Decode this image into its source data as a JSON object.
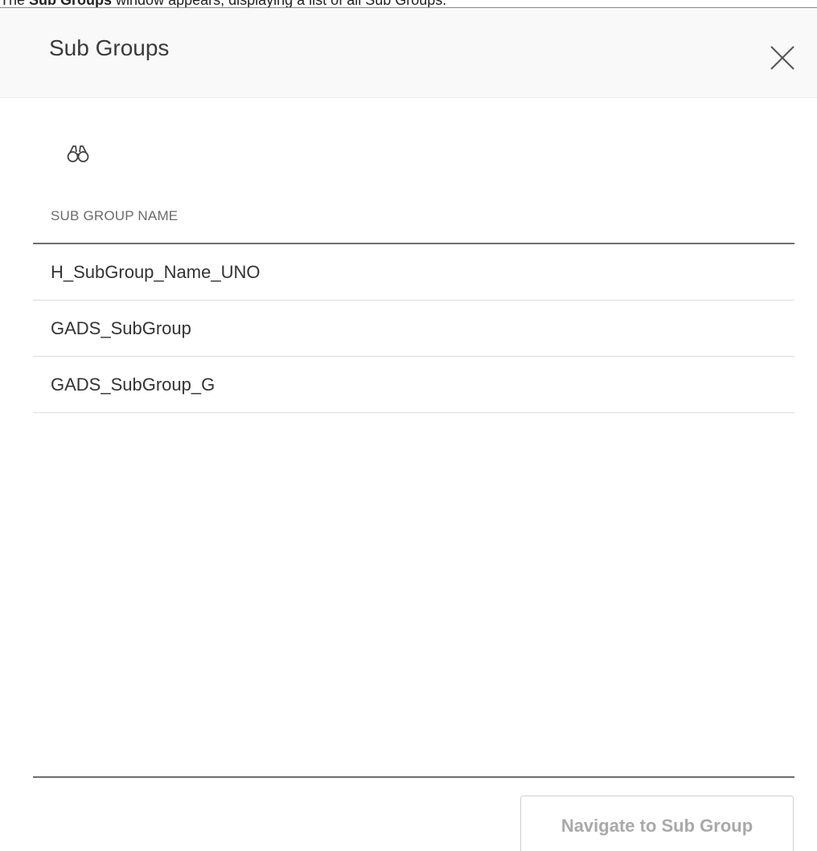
{
  "caption": {
    "prefix": "The ",
    "bold": "Sub Groups",
    "suffix": " window appears, displaying a list of all Sub Groups."
  },
  "dialog": {
    "title": "Sub Groups",
    "close_icon": "close-icon",
    "search_icon": "binoculars-icon"
  },
  "grid": {
    "column_header": "SUB GROUP NAME",
    "rows": [
      "H_SubGroup_Name_UNO",
      "GADS_SubGroup",
      "GADS_SubGroup_G"
    ]
  },
  "footer": {
    "navigate_label": "Navigate to Sub Group"
  },
  "colors": {
    "header_bg": "#f9f9f9",
    "disabled_text": "#a9a9a9",
    "rule": "#6e6e6e"
  }
}
